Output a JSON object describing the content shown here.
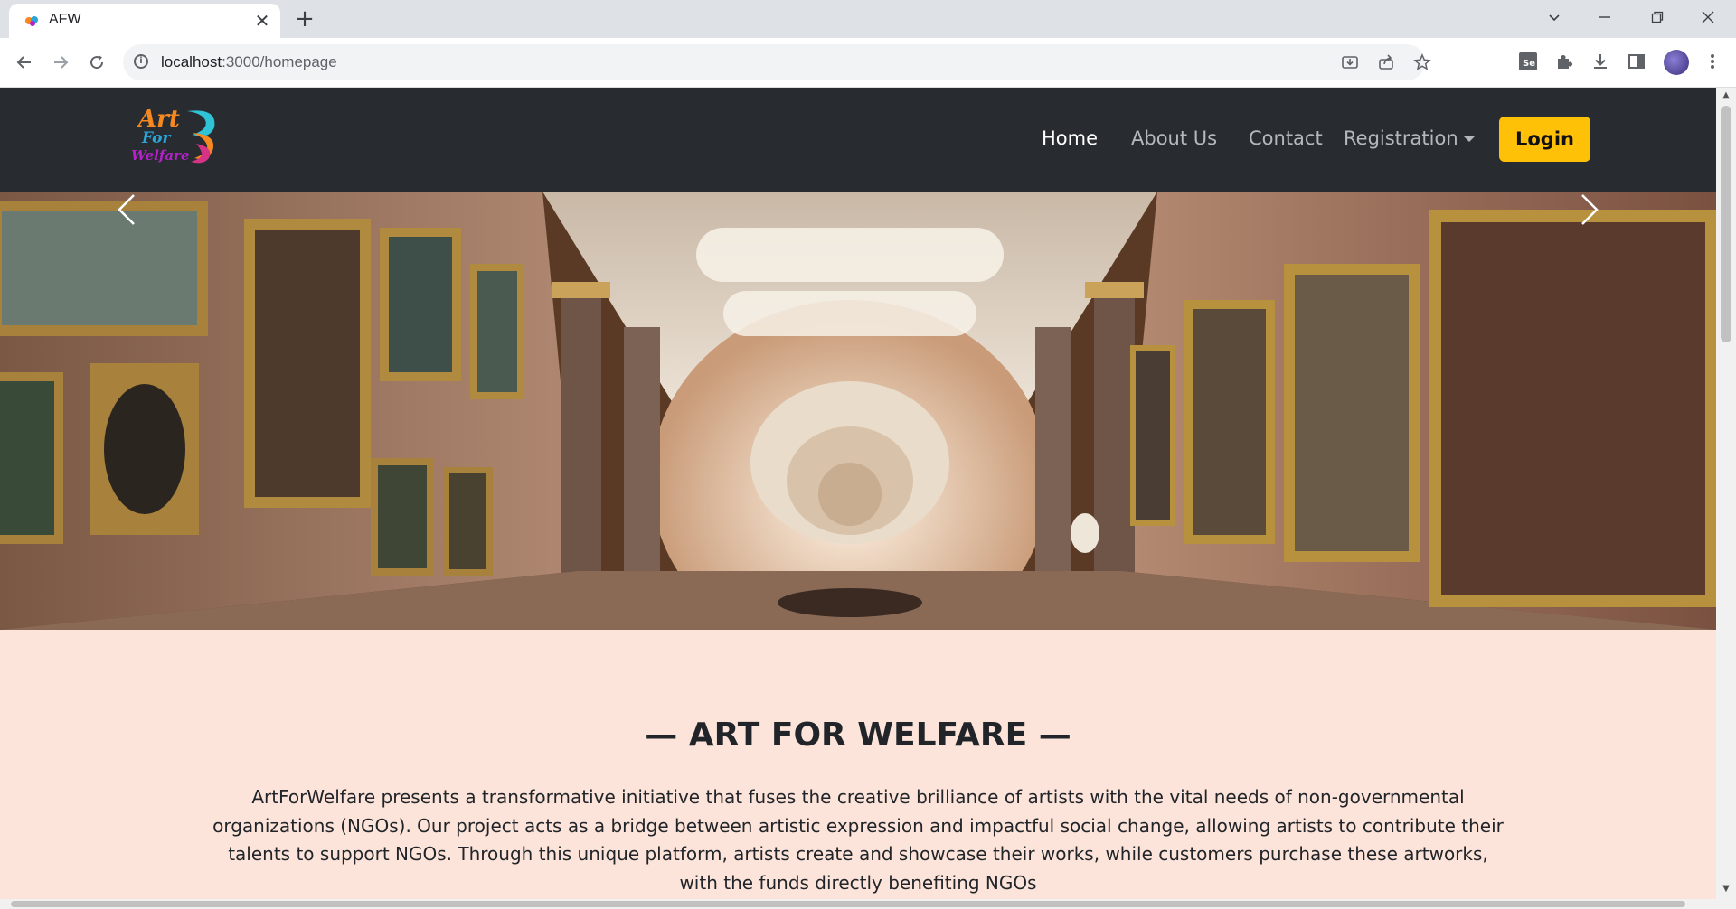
{
  "browser": {
    "tab_title": "AFW",
    "new_tab": "+",
    "close": "✕",
    "url_host": "localhost",
    "url_path": ":3000/homepage"
  },
  "site": {
    "logo": {
      "line1": "Art",
      "line2": "For",
      "line3": "Welfare"
    },
    "nav": {
      "home": "Home",
      "about": "About Us",
      "contact": "Contact",
      "registration": "Registration",
      "login": "Login"
    },
    "section": {
      "title": "— ART FOR WELFARE —",
      "body": "ArtForWelfare presents a transformative initiative that fuses the creative brilliance of artists with the vital needs of non-governmental organizations (NGOs). Our project acts as a bridge between artistic expression and impactful social change, allowing artists to contribute their talents to support NGOs. Through this unique platform, artists create and showcase their works, while customers purchase these artworks, with the funds directly benefiting NGOs"
    }
  },
  "colors": {
    "navbar": "#282c31",
    "accent": "#ffc107",
    "content_bg": "#fde4da",
    "nav_active": "#ffffff",
    "nav_inactive": "#b4b8bd"
  },
  "icons": [
    "back-icon",
    "forward-icon",
    "reload-icon",
    "info-icon",
    "install-icon",
    "share-icon",
    "star-icon",
    "selenium-icon",
    "extensions-icon",
    "download-icon",
    "sidepanel-icon",
    "menu-icon",
    "chevron-left-icon",
    "chevron-right-icon"
  ]
}
